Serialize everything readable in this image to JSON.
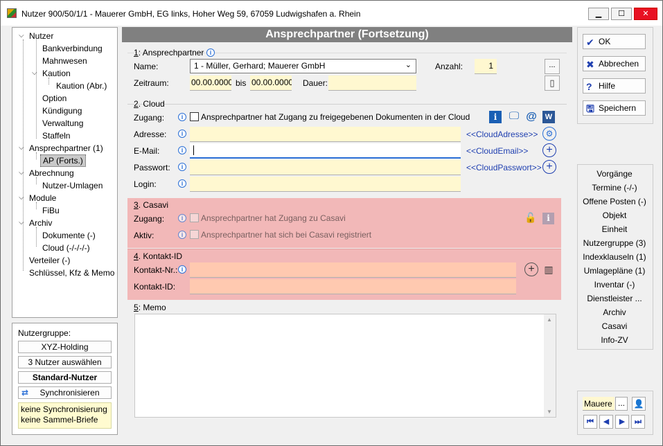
{
  "window": {
    "title": "Nutzer 900/50/1/1 - Mauerer GmbH, EG links, Hoher Weg 59, 67059 Ludwigshafen a. Rhein",
    "min": "▁",
    "max": "☐",
    "close": "✕"
  },
  "tree": {
    "items": [
      {
        "label": "Nutzer",
        "exp": "⌄"
      },
      {
        "label": "Bankverbindung"
      },
      {
        "label": "Mahnwesen"
      },
      {
        "label": "Kaution",
        "exp": "⌄"
      },
      {
        "label": "Kaution (Abr.)"
      },
      {
        "label": "Option"
      },
      {
        "label": "Kündigung"
      },
      {
        "label": "Verwaltung"
      },
      {
        "label": "Staffeln"
      },
      {
        "label": "Ansprechpartner (1)",
        "exp": "⌄"
      },
      {
        "label": "AP (Forts.)"
      },
      {
        "label": "Abrechnung",
        "exp": "⌄"
      },
      {
        "label": "Nutzer-Umlagen"
      },
      {
        "label": "Module",
        "exp": "⌄"
      },
      {
        "label": "FiBu"
      },
      {
        "label": "Archiv",
        "exp": "⌄"
      },
      {
        "label": "Dokumente (-)"
      },
      {
        "label": "Cloud (-/-/-/-)"
      },
      {
        "label": "Verteiler (-)"
      },
      {
        "label": "Schlüssel, Kfz & Memo"
      }
    ]
  },
  "left_bottom": {
    "group_label": "Nutzergruppe:",
    "btn1": "XYZ-Holding",
    "btn2": "3 Nutzer auswählen",
    "btn3": "Standard-Nutzer",
    "sync": "Synchronisieren",
    "note1": "keine Synchronisierung",
    "note2": "keine Sammel-Briefe"
  },
  "header": "Ansprechpartner (Fortsetzung)",
  "ap": {
    "num": "1",
    "title": ": Ansprechpartner",
    "name_label": "Name:",
    "name_value": "1 - Müller, Gerhard; Mauerer GmbH",
    "anzahl_label": "Anzahl:",
    "anzahl_value": "1",
    "zeitraum_label": "Zeitraum:",
    "from": "00.00.0000",
    "bis": "bis",
    "to": "00.00.0000",
    "dauer_label": "Dauer:",
    "dauer_value": "",
    "dots": "..."
  },
  "cloud": {
    "num": "2",
    "title": ". Cloud",
    "zugang_label": "Zugang:",
    "zugang_text": "Ansprechpartner hat Zugang zu freigegebenen Dokumenten in der Cloud",
    "adresse_label": "Adresse:",
    "email_label": "E-Mail:",
    "passwort_label": "Passwort:",
    "login_label": "Login:",
    "adresse_link": "<<CloudAdresse>>",
    "email_link": "<<CloudEmail>>",
    "passwort_link": "<<CloudPasswort>>"
  },
  "casavi": {
    "num": "3",
    "title": ". Casavi",
    "zugang_label": "Zugang:",
    "zugang_text": "Ansprechpartner hat Zugang zu Casavi",
    "aktiv_label": "Aktiv:",
    "aktiv_text": "Ansprechpartner hat sich bei Casavi registriert"
  },
  "kontakt": {
    "num": "4",
    "title": ". Kontakt-ID",
    "nr_label": "Kontakt-Nr.:",
    "id_label": "Kontakt-ID:"
  },
  "memo": {
    "num": "5",
    "title": ": Memo"
  },
  "buttons": {
    "ok": "OK",
    "abbrechen": "Abbrechen",
    "hilfe": "Hilfe",
    "speichern": "Speichern"
  },
  "links": [
    "Vorgänge",
    "Termine (-/-)",
    "Offene Posten (-)",
    "Objekt",
    "Einheit",
    "Nutzergruppe (3)",
    "Indexklauseln (1)",
    "Umlagepläne (1)",
    "Inventar (-)",
    "Dienstleister ...",
    "Archiv",
    "Casavi",
    "Info-ZV"
  ],
  "bottom_right": {
    "search_value": "Mauere",
    "dots": "..."
  },
  "colors": {
    "yellow_field": "#fff8d0",
    "casavi_bg": "#f2b8b8",
    "orange_field": "#ffc9b0",
    "header_bg": "#808080"
  }
}
